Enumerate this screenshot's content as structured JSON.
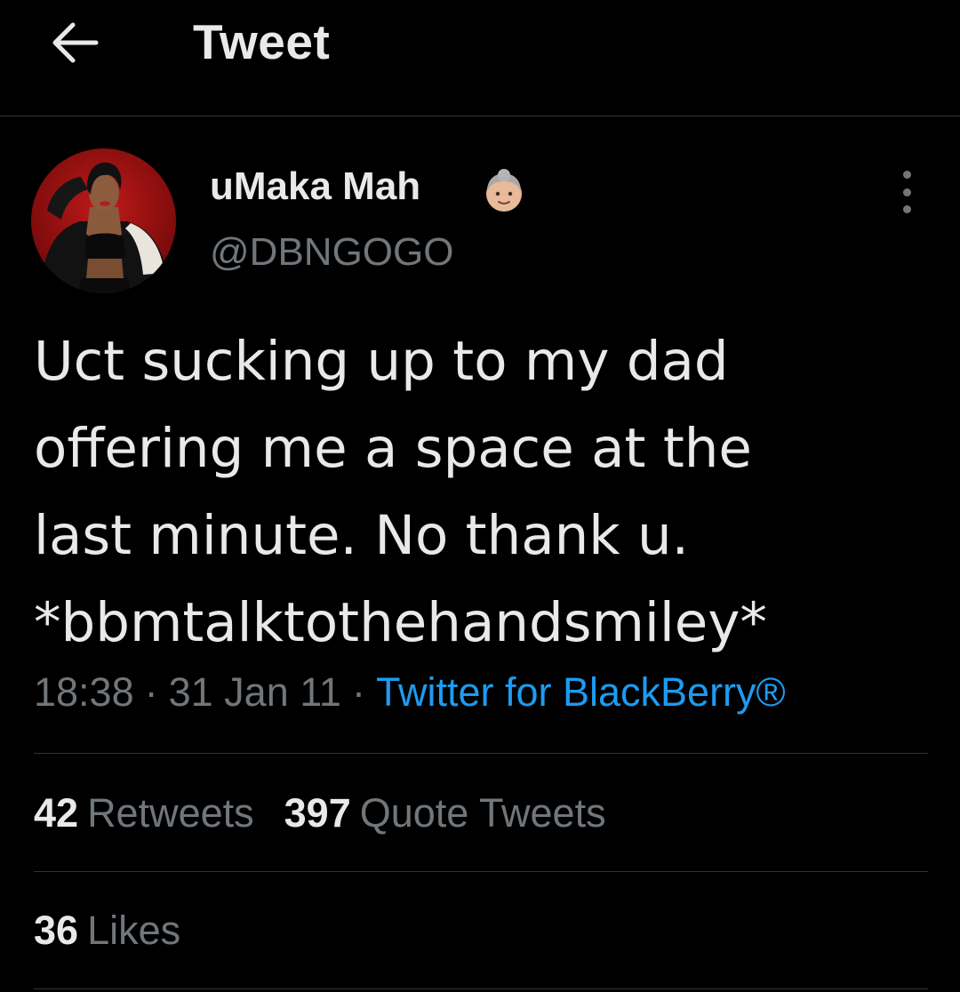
{
  "header": {
    "title": "Tweet",
    "back_icon": "arrow-left-icon"
  },
  "author": {
    "display_name": "uMaka Mah",
    "handle": "@DBNGOGO",
    "badge_icon": "older-woman-emoji-icon",
    "more_icon": "more-vertical-icon"
  },
  "tweet": {
    "lines": [
      "Uct sucking up to my dad",
      "offering me a space at the",
      "last minute. No thank u.",
      "*bbmtalktothehandsmiley*"
    ],
    "time": "18:38",
    "date": "31 Jan 11",
    "separator": "·",
    "source": "Twitter for BlackBerry®"
  },
  "stats": {
    "retweets": {
      "count": "42",
      "label": "Retweets"
    },
    "quote_tweets": {
      "count": "397",
      "label": "Quote Tweets"
    },
    "likes": {
      "count": "36",
      "label": "Likes"
    }
  },
  "colors": {
    "background": "#000000",
    "primary_text": "#e7e9ea",
    "secondary_text": "#71767b",
    "link": "#1d9bf0",
    "divider": "#2f3336"
  }
}
